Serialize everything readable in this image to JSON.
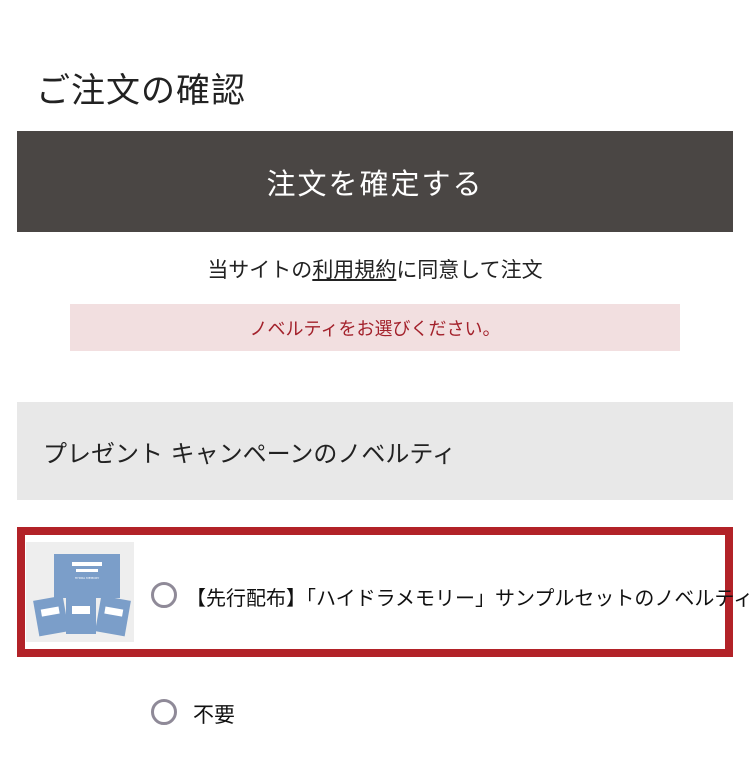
{
  "page": {
    "title": "ご注文の確認",
    "confirm_button": "注文を確定する",
    "agree_prefix": "当サイトの",
    "terms_link": "利用規約",
    "agree_suffix": "に同意して注文",
    "error_message": "ノベルティをお選びください。"
  },
  "novelty": {
    "heading": "プレゼント キャンペーンのノベルティ",
    "options": [
      {
        "label": "【先行配布】「ハイドラメモリー」サンプルセットのノベルティ",
        "selected": false,
        "has_thumbnail": true
      },
      {
        "label": "不要",
        "selected": false,
        "has_thumbnail": false
      }
    ],
    "thumbnail_card_text": "HYDRA MEMORY"
  },
  "colors": {
    "button_bg": "#4a4644",
    "error_bg": "#f2dfe0",
    "error_text": "#a3212b",
    "highlight_border": "#b22228",
    "section_bg": "#e8e8e8"
  }
}
